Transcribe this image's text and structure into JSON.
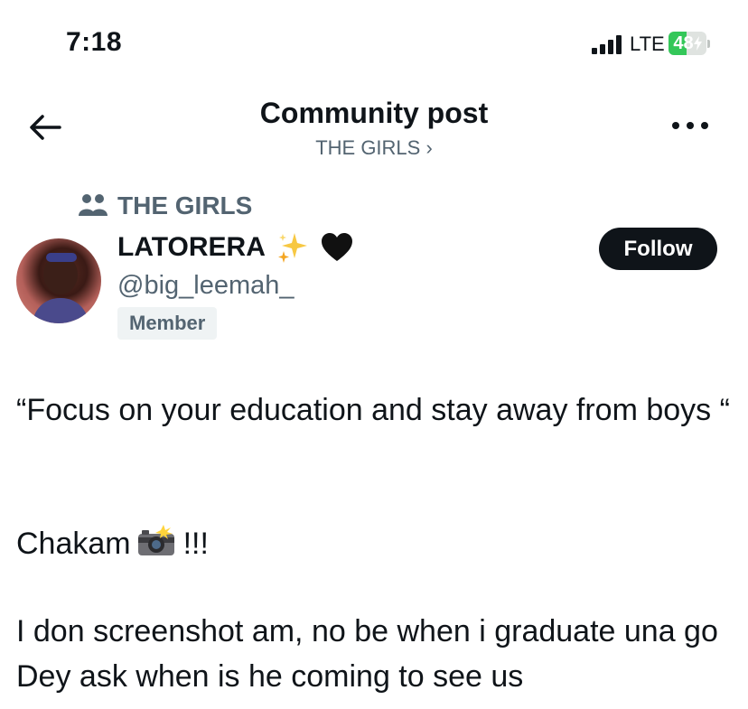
{
  "status_bar": {
    "time": "7:18",
    "network": "LTE",
    "battery": "48",
    "battery_level": 0.48,
    "battery_color": "#34c759",
    "signal_icon": "signal-bars-icon",
    "charging_icon": "bolt-icon"
  },
  "header": {
    "title": "Community post",
    "subtitle": "THE GIRLS ›",
    "back_icon": "arrow-left-icon",
    "more_icon": "more-horizontal-icon"
  },
  "community": {
    "icon": "people-icon",
    "name": "THE GIRLS"
  },
  "author": {
    "display_name": "LATORERA",
    "name_emojis": [
      "sparkles-icon",
      "black-heart-icon"
    ],
    "handle": "@big_leemah_",
    "badge": "Member"
  },
  "follow_button": {
    "label": "Follow",
    "color": "#0f1419"
  },
  "post": {
    "paragraph_1": "“Focus on your education and stay away from boys “",
    "paragraph_2_text": "Chakam",
    "paragraph_2_emoji": "camera-flash-icon",
    "paragraph_2_suffix": "!!!",
    "paragraph_3": "I don screenshot am, no be when i graduate una go Dey ask when is he coming to see us"
  },
  "colors": {
    "text": "#0f1419",
    "secondary": "#536471",
    "badge_bg": "#eff3f4"
  }
}
